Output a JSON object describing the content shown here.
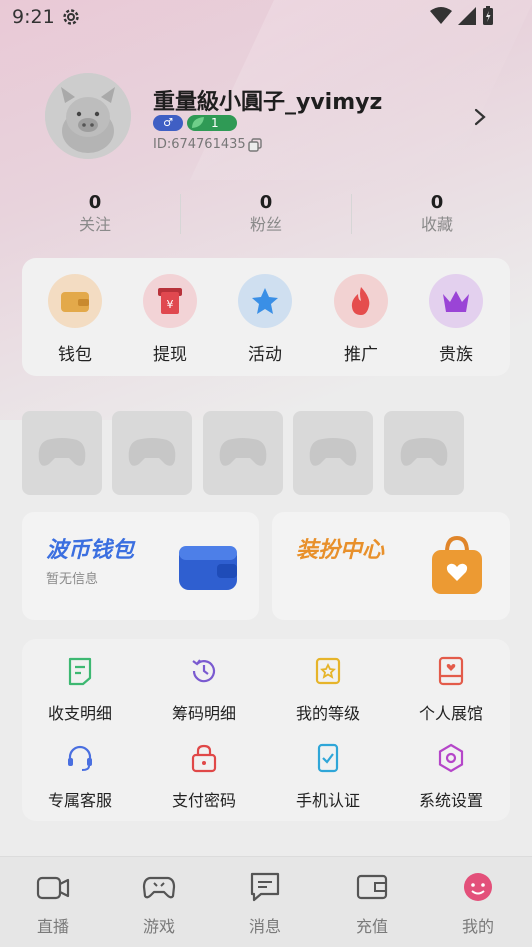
{
  "status_bar": {
    "time": "9:21"
  },
  "profile": {
    "nickname": "重量級小圓子_yvimyz",
    "gender_symbol": "♂",
    "level": "1",
    "user_id": "ID:674761435"
  },
  "stats": [
    {
      "count": "0",
      "label": "关注"
    },
    {
      "count": "0",
      "label": "粉丝"
    },
    {
      "count": "0",
      "label": "收藏"
    }
  ],
  "quick_actions": [
    {
      "label": "钱包",
      "icon": "wallet-icon",
      "color": "#e3a94a"
    },
    {
      "label": "提现",
      "icon": "withdraw-icon",
      "color": "#e0484f"
    },
    {
      "label": "活动",
      "icon": "star-icon",
      "color": "#3a8fe6"
    },
    {
      "label": "推广",
      "icon": "flame-icon",
      "color": "#e54d4d"
    },
    {
      "label": "贵族",
      "icon": "crown-icon",
      "color": "#9a44d6"
    }
  ],
  "promos": {
    "wallet": {
      "title": "波币钱包",
      "subtitle": "暂无信息",
      "color": "#3b6fe0"
    },
    "dressup": {
      "title": "装扮中心",
      "color": "#e8902b"
    }
  },
  "menu": [
    {
      "label": "收支明细",
      "icon": "receipt-icon",
      "color": "#3db872"
    },
    {
      "label": "筹码明细",
      "icon": "history-icon",
      "color": "#7a5ad0"
    },
    {
      "label": "我的等级",
      "icon": "level-star-icon",
      "color": "#e6b42a"
    },
    {
      "label": "个人展馆",
      "icon": "gallery-icon",
      "color": "#e35b4a"
    },
    {
      "label": "专属客服",
      "icon": "headset-icon",
      "color": "#4a6fe0"
    },
    {
      "label": "支付密码",
      "icon": "lock-icon",
      "color": "#e04848"
    },
    {
      "label": "手机认证",
      "icon": "phone-check-icon",
      "color": "#2fa6d8"
    },
    {
      "label": "系统设置",
      "icon": "settings-hex-icon",
      "color": "#b546c9"
    }
  ],
  "bottom_nav": [
    {
      "label": "直播",
      "icon": "live-camera-icon"
    },
    {
      "label": "游戏",
      "icon": "gamepad-icon"
    },
    {
      "label": "消息",
      "icon": "message-icon"
    },
    {
      "label": "充值",
      "icon": "wallet-outline-icon"
    },
    {
      "label": "我的",
      "icon": "profile-face-icon",
      "active_color": "#e3507a"
    }
  ]
}
